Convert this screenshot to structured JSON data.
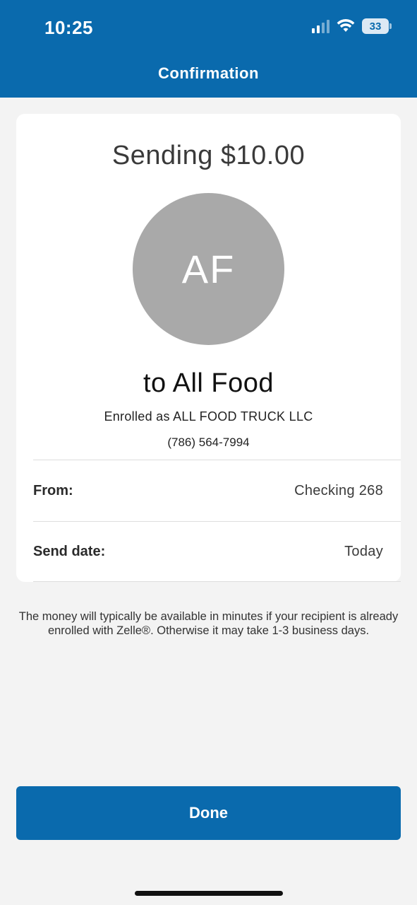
{
  "status_bar": {
    "time": "10:25",
    "battery": "33"
  },
  "header": {
    "title": "Confirmation"
  },
  "card": {
    "sending": "Sending $10.00",
    "avatar_initials": "AF",
    "recipient": "to All Food",
    "enrolled": "Enrolled as ALL FOOD TRUCK LLC",
    "phone": "(786) 564-7994",
    "rows": [
      {
        "label": "From:",
        "value": "Checking 268"
      },
      {
        "label": "Send date:",
        "value": "Today"
      }
    ]
  },
  "note": "The money will typically be available in minutes if your recipient is already enrolled with Zelle®. Otherwise it may take 1-3 business days.",
  "done_label": "Done",
  "colors": {
    "header": "#0a6aad",
    "button": "#0a6aad",
    "avatar": "#a9a9a9",
    "background": "#f3f3f3"
  }
}
